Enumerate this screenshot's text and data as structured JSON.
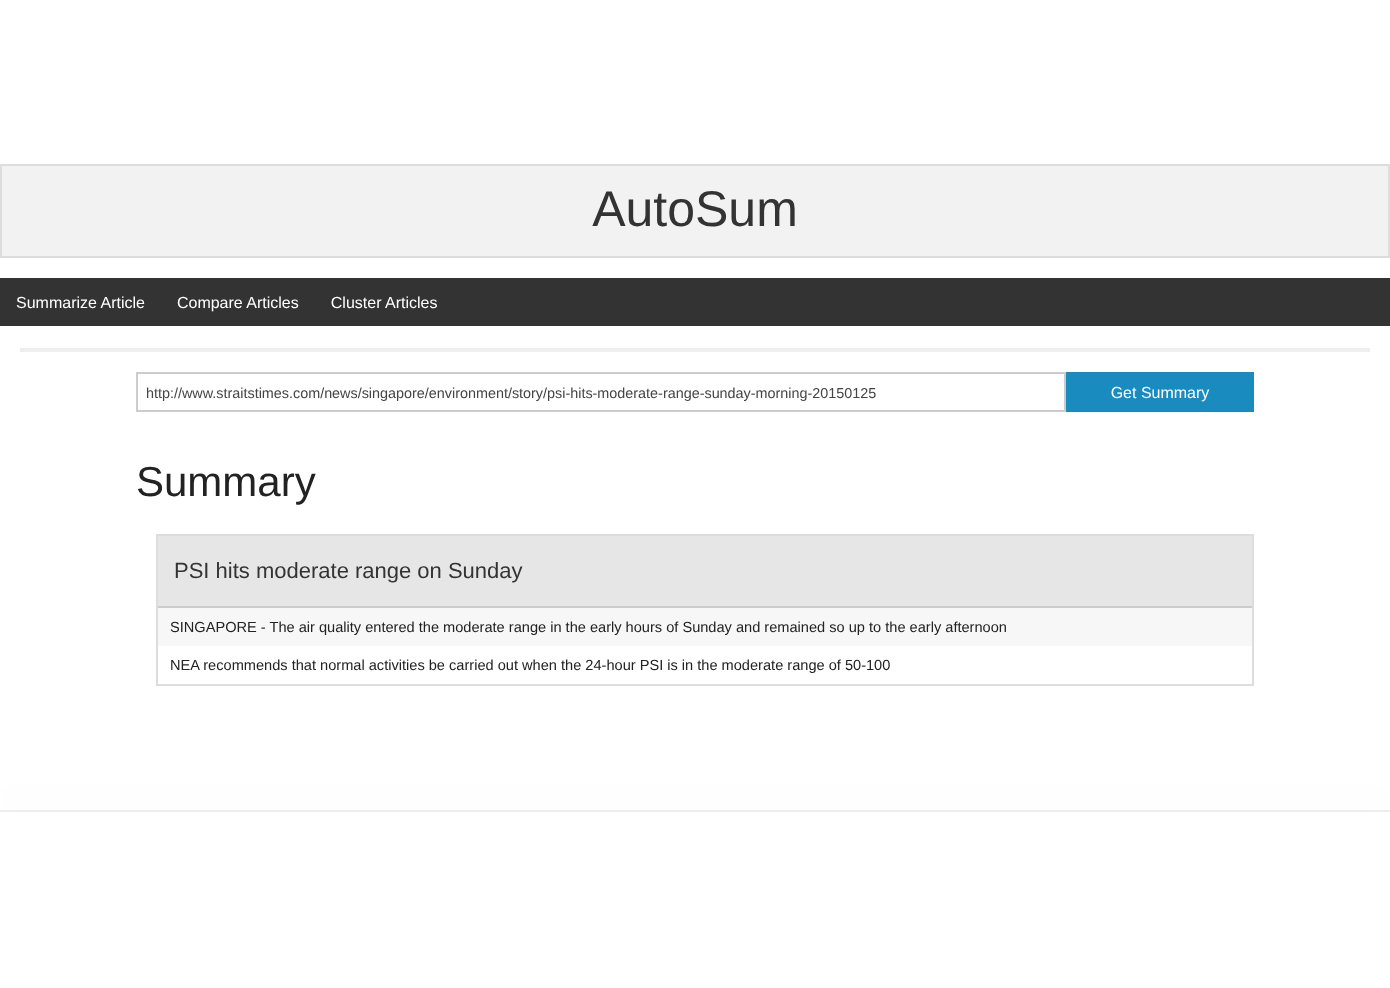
{
  "header": {
    "title": "AutoSum"
  },
  "nav": {
    "items": [
      "Summarize Article",
      "Compare Articles",
      "Cluster Articles"
    ]
  },
  "url_form": {
    "value": "http://www.straitstimes.com/news/singapore/environment/story/psi-hits-moderate-range-sunday-morning-20150125",
    "button": "Get Summary"
  },
  "summary": {
    "heading": "Summary",
    "panel_title": "PSI hits moderate range on Sunday",
    "sentences": [
      "SINGAPORE - The air quality entered the moderate range in the early hours of Sunday and remained so up to the early afternoon",
      "NEA recommends that normal activities be carried out when the 24-hour PSI is in the moderate range of 50-100"
    ]
  }
}
